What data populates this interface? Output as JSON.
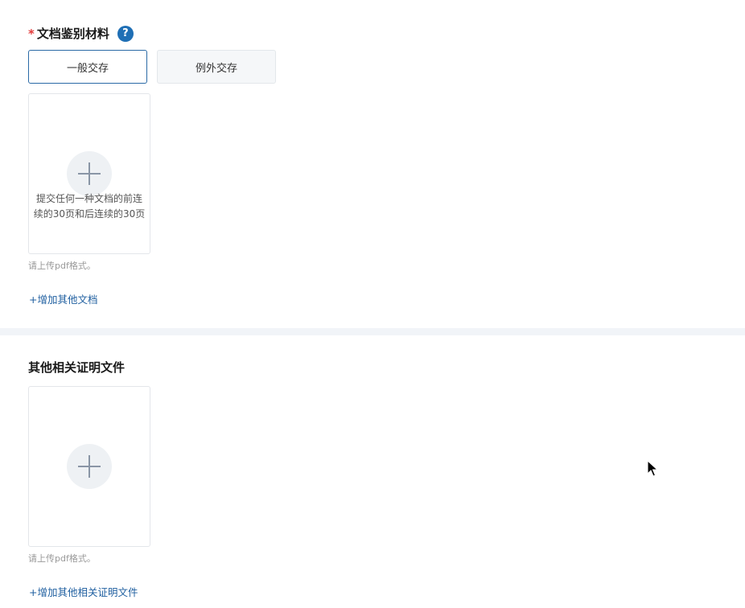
{
  "section1": {
    "required_mark": "*",
    "title": "文档鉴别材料",
    "help_icon_glyph": "?",
    "toggle": {
      "general": "一般交存",
      "exception": "例外交存",
      "selected": "一般交存"
    },
    "upload": {
      "text": "提交任何一种文档的前连续的30页和后连续的30页"
    },
    "hint": "请上传pdf格式。",
    "add_link": "+增加其他文档"
  },
  "section2": {
    "title": "其他相关证明文件",
    "hint": "请上传pdf格式。",
    "add_link": "+增加其他相关证明文件"
  },
  "colors": {
    "accent": "#2b6aa6",
    "required": "#e23b3b",
    "link": "#1f5fa0",
    "divider": "#f1f4f8"
  }
}
